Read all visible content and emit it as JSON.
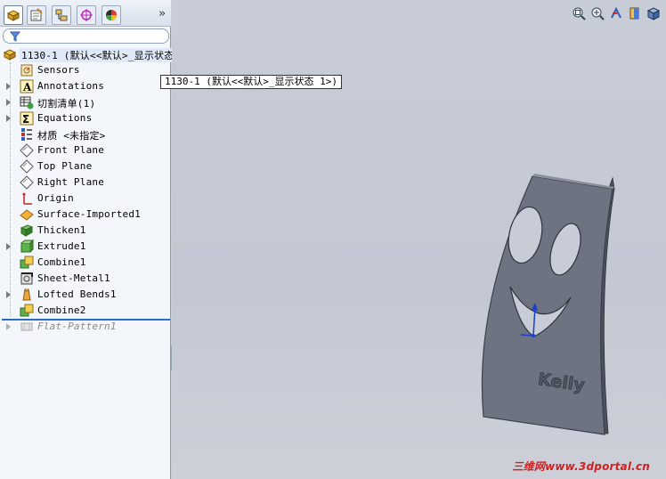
{
  "tabs": [
    {
      "name": "feature-manager",
      "icon": "part-tree-icon",
      "active": true
    },
    {
      "name": "property-manager",
      "icon": "property-manager-icon",
      "active": false
    },
    {
      "name": "configuration-manager",
      "icon": "configuration-manager-icon",
      "active": false
    },
    {
      "name": "dimxpert-manager",
      "icon": "dimxpert-icon",
      "active": false
    },
    {
      "name": "display-manager",
      "icon": "display-manager-icon",
      "active": false
    }
  ],
  "expand_tabs_label": "»",
  "tree": {
    "root": "1130-1  (默认<<默认>_显示状态 1>)",
    "items": [
      {
        "label": "Sensors",
        "icon": "sensors-icon",
        "expandable": false
      },
      {
        "label": "Annotations",
        "icon": "annotations-icon",
        "expandable": true
      },
      {
        "label": "切割清单(1)",
        "icon": "cut-list-icon",
        "expandable": true
      },
      {
        "label": "Equations",
        "icon": "equations-icon",
        "expandable": true
      },
      {
        "label": "材质 <未指定>",
        "icon": "material-icon",
        "expandable": false
      },
      {
        "label": "Front Plane",
        "icon": "plane-icon",
        "expandable": false
      },
      {
        "label": "Top Plane",
        "icon": "plane-icon",
        "expandable": false
      },
      {
        "label": "Right Plane",
        "icon": "plane-icon",
        "expandable": false
      },
      {
        "label": "Origin",
        "icon": "origin-icon",
        "expandable": false
      },
      {
        "label": "Surface-Imported1",
        "icon": "surface-imported-icon",
        "expandable": false
      },
      {
        "label": "Thicken1",
        "icon": "thicken-icon",
        "expandable": false
      },
      {
        "label": "Extrude1",
        "icon": "extrude-icon",
        "expandable": true
      },
      {
        "label": "Combine1",
        "icon": "combine-icon",
        "expandable": false
      },
      {
        "label": "Sheet-Metal1",
        "icon": "sheet-metal-icon",
        "expandable": false
      },
      {
        "label": "Lofted Bends1",
        "icon": "lofted-bends-icon",
        "expandable": true
      },
      {
        "label": "Combine2",
        "icon": "combine-icon",
        "expandable": false
      },
      {
        "label": "Flat-Pattern1",
        "icon": "flat-pattern-icon",
        "expandable": true,
        "suppressed": true
      }
    ]
  },
  "tooltip": "1130-1  (默认<<默认>_显示状态 1>)",
  "view_tools": [
    "zoom-to-fit-icon",
    "zoom-to-area-icon",
    "previous-view-icon",
    "section-view-icon",
    "view-orientation-icon"
  ],
  "part_engraving": "Kelly",
  "watermark": "三维网www.3dportal.cn",
  "colors": {
    "part": "#6d7381",
    "part_edge": "#3b404b",
    "rollback": "#2b6cc4",
    "watermark": "#cc2222"
  }
}
